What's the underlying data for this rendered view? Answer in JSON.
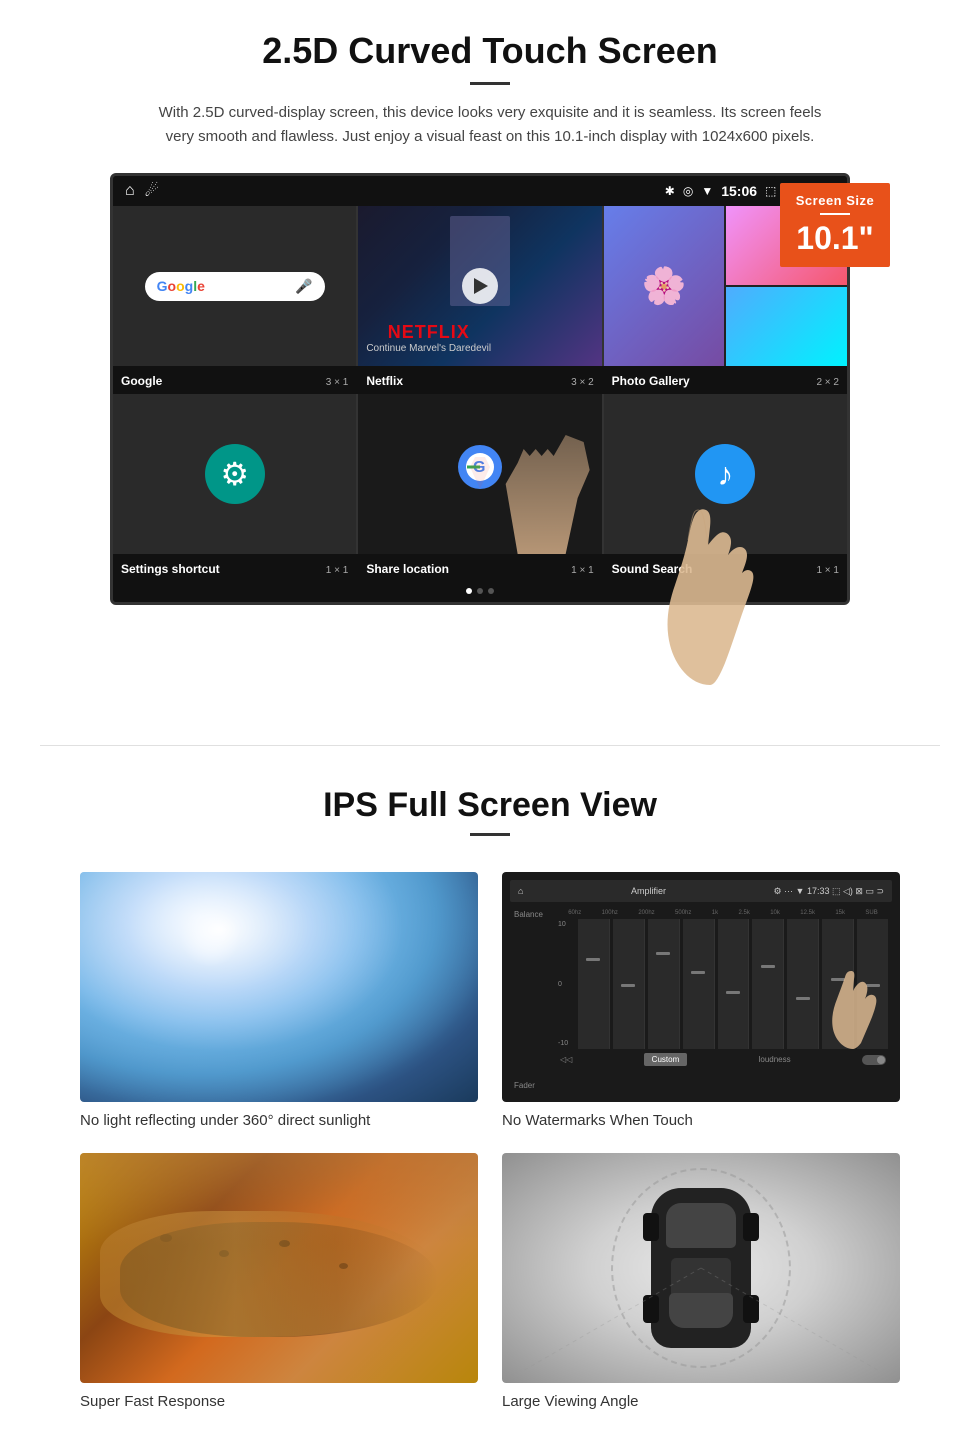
{
  "section_curved": {
    "title": "2.5D Curved Touch Screen",
    "description": "With 2.5D curved-display screen, this device looks very exquisite and it is seamless. Its screen feels very smooth and flawless. Just enjoy a visual feast on this 10.1-inch display with 1024x600 pixels.",
    "screen_badge": {
      "title": "Screen Size",
      "size": "10.1\""
    },
    "status_bar": {
      "time": "15:06"
    },
    "apps": [
      {
        "name": "Google",
        "grid": "3 × 1"
      },
      {
        "name": "Netflix",
        "grid": "3 × 2"
      },
      {
        "name": "Photo Gallery",
        "grid": "2 × 2"
      },
      {
        "name": "Settings shortcut",
        "grid": "1 × 1"
      },
      {
        "name": "Share location",
        "grid": "1 × 1"
      },
      {
        "name": "Sound Search",
        "grid": "1 × 1"
      }
    ],
    "netflix_text": "NETFLIX",
    "netflix_subtitle": "Continue Marvel's Daredevil"
  },
  "section_ips": {
    "title": "IPS Full Screen View",
    "features": [
      {
        "id": "sunlight",
        "caption": "No light reflecting under 360° direct sunlight"
      },
      {
        "id": "equalizer",
        "caption": "No Watermarks When Touch"
      },
      {
        "id": "cheetah",
        "caption": "Super Fast Response"
      },
      {
        "id": "car",
        "caption": "Large Viewing Angle"
      }
    ],
    "eq": {
      "app_name": "Amplifier",
      "time": "17:33",
      "labels": [
        "60hz",
        "100hz",
        "200hz",
        "500hz",
        "1k",
        "2.5k",
        "10k",
        "12.5k",
        "15k",
        "SUB"
      ],
      "balance_label": "Balance",
      "fader_label": "Fader",
      "custom_btn": "Custom",
      "loudness_label": "loudness"
    }
  }
}
